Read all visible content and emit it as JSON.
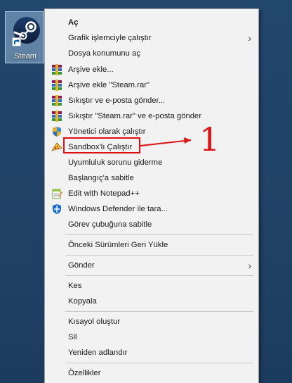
{
  "desktop_icon": {
    "label": "Steam",
    "icon": "steam-icon"
  },
  "menu": {
    "items": [
      {
        "label": "Aç",
        "bold": true
      },
      {
        "label": "Grafik işlemciyle çalıştır",
        "submenu": true
      },
      {
        "label": "Dosya konumunu aç"
      },
      {
        "label": "Arşive ekle...",
        "icon": "winrar-icon"
      },
      {
        "label": "Arşive ekle \"Steam.rar\"",
        "icon": "winrar-icon"
      },
      {
        "label": "Sıkıştır ve e-posta gönder...",
        "icon": "winrar-icon"
      },
      {
        "label": "Sıkıştır \"Steam.rar\" ve e-posta gönder",
        "icon": "winrar-icon"
      },
      {
        "label": "Yönetici olarak çalıştır",
        "icon": "uac-shield-icon"
      },
      {
        "label": "Sandbox'lı Çalıştır",
        "icon": "sandboxie-icon"
      },
      {
        "label": "Uyumluluk sorunu giderme"
      },
      {
        "label": "Başlangıç'a sabitle"
      },
      {
        "label": "Edit with Notepad++",
        "icon": "notepad-plus-plus-icon"
      },
      {
        "label": "Windows Defender ile tara...",
        "icon": "windows-defender-icon"
      },
      {
        "label": "Görev çubuğuna sabitle"
      },
      {
        "label": "Önceki Sürümleri Geri Yükle"
      },
      {
        "label": "Gönder",
        "submenu": true
      },
      {
        "label": "Kes"
      },
      {
        "label": "Kopyala"
      },
      {
        "label": "Kısayol oluştur"
      },
      {
        "label": "Sil"
      },
      {
        "label": "Yeniden adlandır"
      },
      {
        "label": "Özellikler"
      }
    ]
  },
  "annotation": {
    "number": "1",
    "color": "#e01010"
  }
}
